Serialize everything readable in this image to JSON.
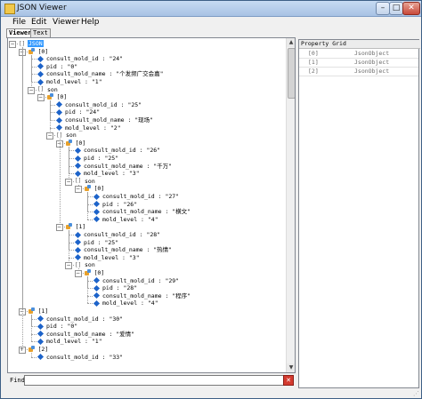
{
  "window": {
    "title": "JSON Viewer",
    "controls": {
      "minimize": "–",
      "maximize": "□",
      "close": "✕"
    }
  },
  "menu": [
    "File",
    "Edit",
    "Viewer",
    "Help"
  ],
  "tabs": [
    {
      "label": "Viewer",
      "active": true
    },
    {
      "label": "Text",
      "active": false
    }
  ],
  "tree": [
    {
      "depth": 0,
      "icon": "array",
      "expander": "minus",
      "text": "JSON",
      "selected": true
    },
    {
      "depth": 1,
      "icon": "object",
      "expander": "minus",
      "text": "[0]"
    },
    {
      "depth": 2,
      "icon": "value",
      "text": "consult_mold_id : \"24\""
    },
    {
      "depth": 2,
      "icon": "value",
      "text": "pid : \"0\""
    },
    {
      "depth": 2,
      "icon": "value",
      "text": "consult_mold_name : \"个发频广交会嘉\""
    },
    {
      "depth": 2,
      "icon": "value",
      "text": "mold_level : \"1\""
    },
    {
      "depth": 2,
      "icon": "array",
      "expander": "minus",
      "text": "son"
    },
    {
      "depth": 3,
      "icon": "object",
      "expander": "minus",
      "text": "[0]"
    },
    {
      "depth": 4,
      "icon": "value",
      "text": "consult_mold_id : \"25\""
    },
    {
      "depth": 4,
      "icon": "value",
      "text": "pid : \"24\""
    },
    {
      "depth": 4,
      "icon": "value",
      "text": "consult_mold_name : \"现场\""
    },
    {
      "depth": 4,
      "icon": "value",
      "text": "mold_level : \"2\""
    },
    {
      "depth": 4,
      "icon": "array",
      "expander": "minus",
      "text": "son"
    },
    {
      "depth": 5,
      "icon": "object",
      "expander": "minus",
      "text": "[0]"
    },
    {
      "depth": 6,
      "icon": "value",
      "text": "consult_mold_id : \"26\""
    },
    {
      "depth": 6,
      "icon": "value",
      "text": "pid : \"25\""
    },
    {
      "depth": 6,
      "icon": "value",
      "text": "consult_mold_name : \"千万\""
    },
    {
      "depth": 6,
      "icon": "value",
      "text": "mold_level : \"3\""
    },
    {
      "depth": 6,
      "icon": "array",
      "expander": "minus",
      "text": "son"
    },
    {
      "depth": 7,
      "icon": "object",
      "expander": "minus",
      "text": "[0]"
    },
    {
      "depth": 8,
      "icon": "value",
      "text": "consult_mold_id : \"27\""
    },
    {
      "depth": 8,
      "icon": "value",
      "text": "pid : \"26\""
    },
    {
      "depth": 8,
      "icon": "value",
      "text": "consult_mold_name : \"横文\""
    },
    {
      "depth": 8,
      "icon": "value",
      "text": "mold_level : \"4\""
    },
    {
      "depth": 5,
      "icon": "object",
      "expander": "minus",
      "text": "[1]"
    },
    {
      "depth": 6,
      "icon": "value",
      "text": "consult_mold_id : \"28\""
    },
    {
      "depth": 6,
      "icon": "value",
      "text": "pid : \"25\""
    },
    {
      "depth": 6,
      "icon": "value",
      "text": "consult_mold_name : \"热情\""
    },
    {
      "depth": 6,
      "icon": "value",
      "text": "mold_level : \"3\""
    },
    {
      "depth": 6,
      "icon": "array",
      "expander": "minus",
      "text": "son"
    },
    {
      "depth": 7,
      "icon": "object",
      "expander": "minus",
      "text": "[0]"
    },
    {
      "depth": 8,
      "icon": "value",
      "text": "consult_mold_id : \"29\""
    },
    {
      "depth": 8,
      "icon": "value",
      "text": "pid : \"28\""
    },
    {
      "depth": 8,
      "icon": "value",
      "text": "consult_mold_name : \"程序\""
    },
    {
      "depth": 8,
      "icon": "value",
      "text": "mold_level : \"4\""
    },
    {
      "depth": 1,
      "icon": "object",
      "expander": "minus",
      "text": "[1]"
    },
    {
      "depth": 2,
      "icon": "value",
      "text": "consult_mold_id : \"30\""
    },
    {
      "depth": 2,
      "icon": "value",
      "text": "pid : \"0\""
    },
    {
      "depth": 2,
      "icon": "value",
      "text": "consult_mold_name : \"爱情\""
    },
    {
      "depth": 2,
      "icon": "value",
      "text": "mold_level : \"1\""
    },
    {
      "depth": 1,
      "icon": "object",
      "expander": "plus",
      "text": "[2]"
    },
    {
      "depth": 2,
      "icon": "value",
      "text": "consult_mold_id : \"33\""
    }
  ],
  "property_grid": {
    "title": "Property Grid",
    "rows": [
      {
        "key": "[0]",
        "value": "JsonObject"
      },
      {
        "key": "[1]",
        "value": "JsonObject"
      },
      {
        "key": "[2]",
        "value": "JsonObject"
      }
    ]
  },
  "find": {
    "label": "Find",
    "value": "",
    "clear_icon": "✕"
  },
  "scroll": {
    "up": "▲",
    "down": "▼"
  },
  "status": {
    "grip": "⋰"
  }
}
